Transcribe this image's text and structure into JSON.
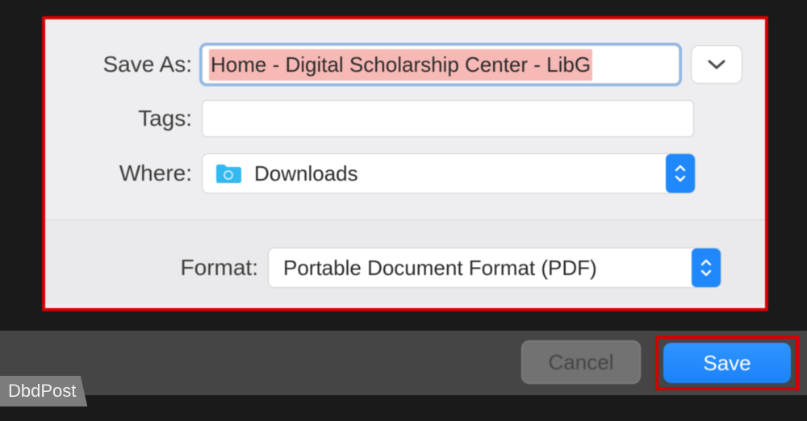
{
  "labels": {
    "save_as": "Save As:",
    "tags": "Tags:",
    "where": "Where:",
    "format": "Format:"
  },
  "save_as": {
    "value": "Home - Digital Scholarship Center - LibG"
  },
  "tags": {
    "value": ""
  },
  "where": {
    "selected": "Downloads"
  },
  "format": {
    "selected": "Portable Document Format (PDF)"
  },
  "buttons": {
    "cancel": "Cancel",
    "save": "Save"
  },
  "watermark": "DbdPost"
}
